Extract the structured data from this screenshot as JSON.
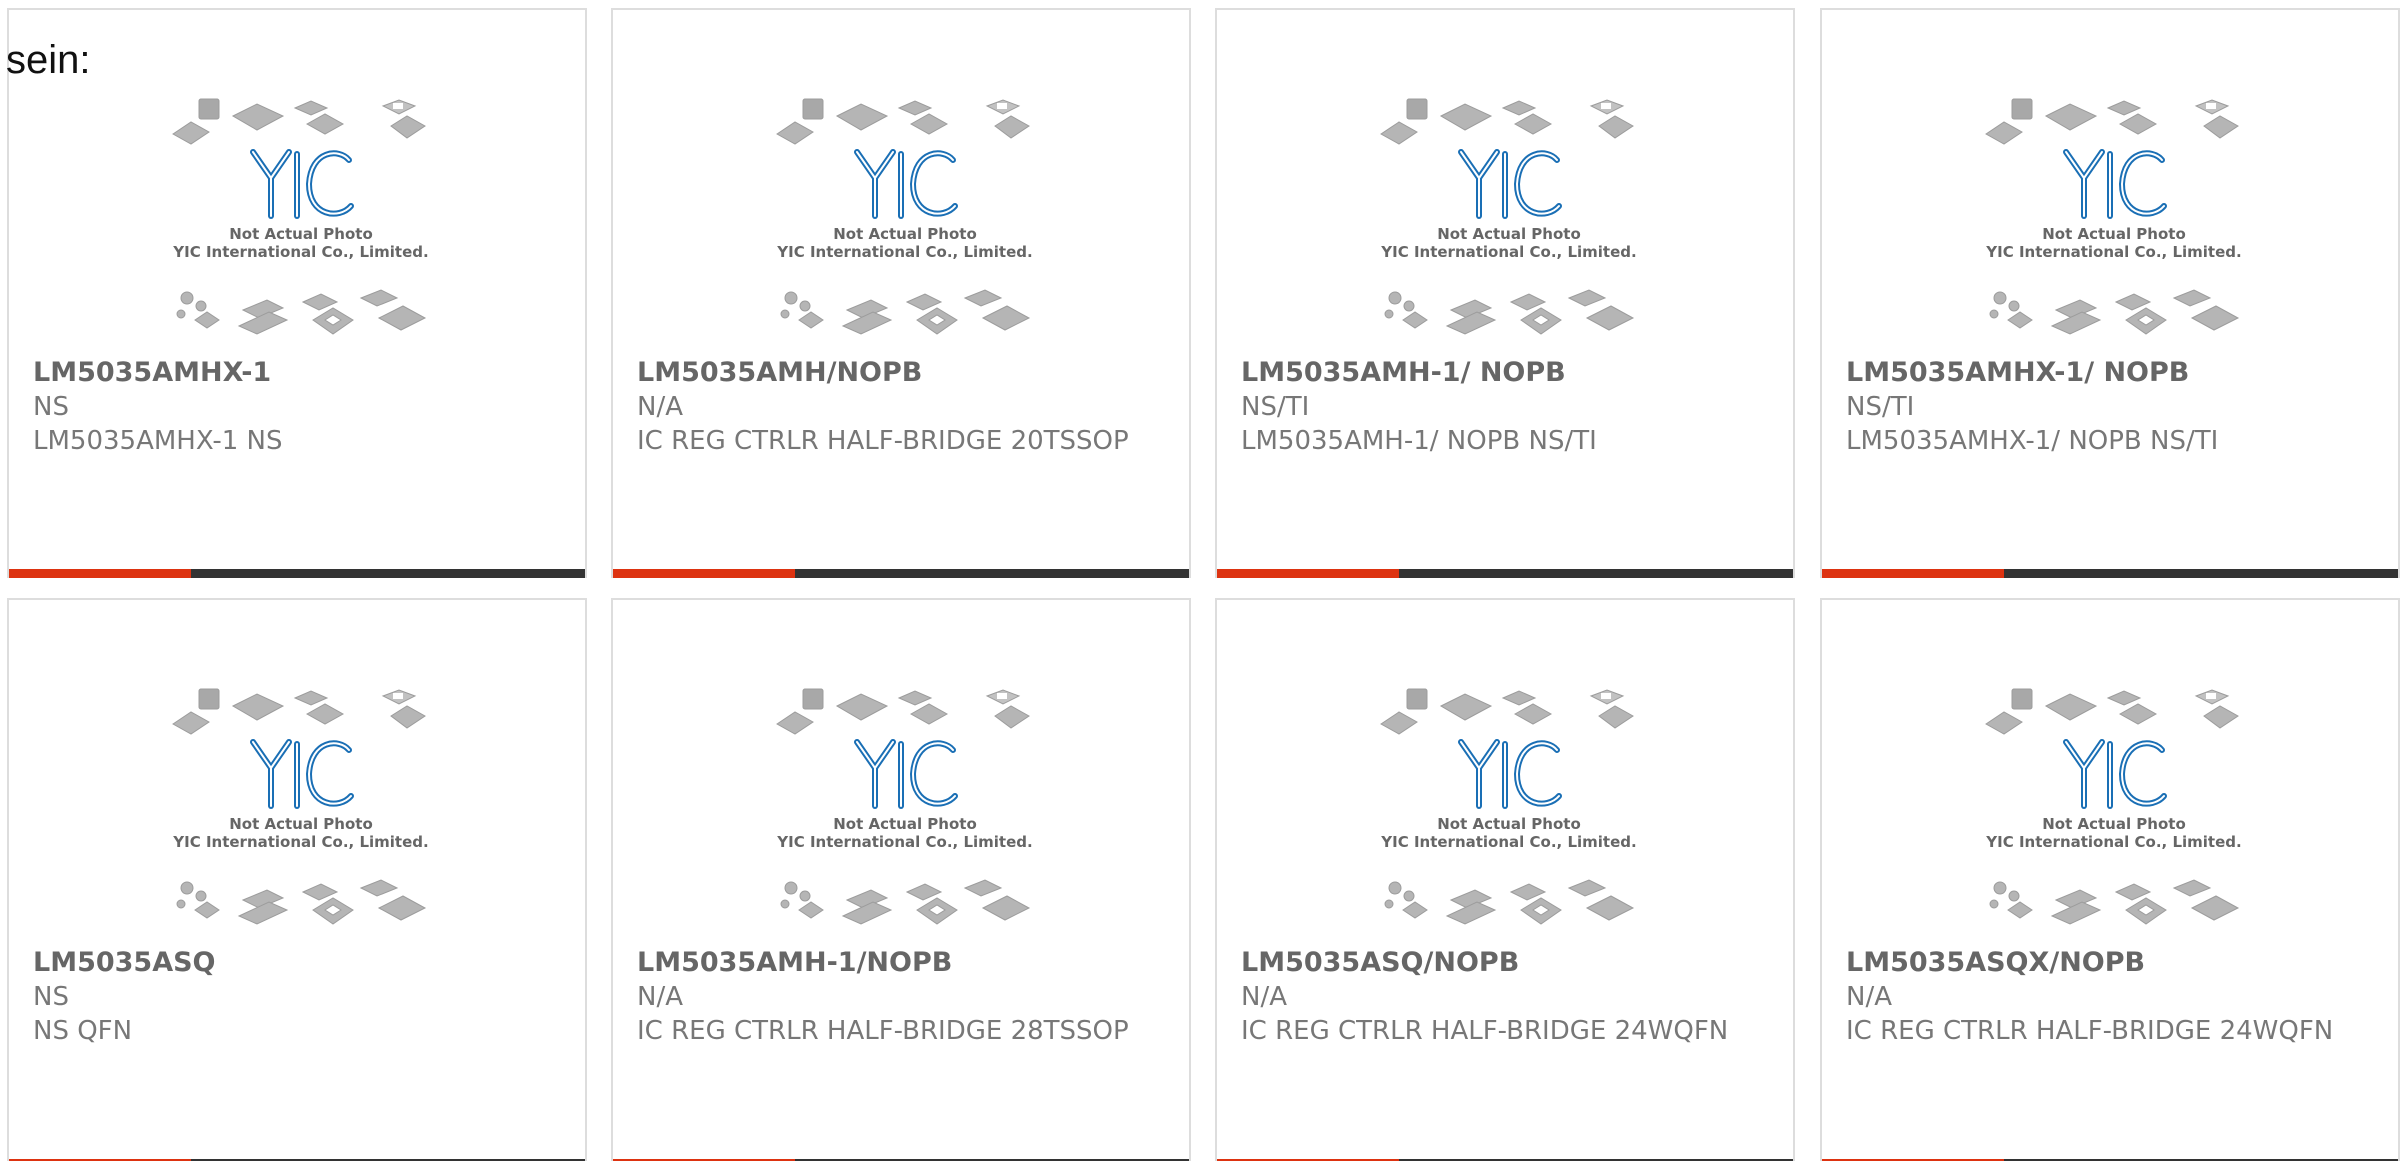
{
  "fragment_text": "sein:",
  "placeholder_photo": {
    "logo_text": "YIC",
    "caption_line1": "Not Actual Photo",
    "caption_line2": "YIC International Co., Limited."
  },
  "colors": {
    "accent": "#dd3311",
    "bar_dark": "#333333",
    "logo_blue": "#1a6fb5",
    "text_gray": "#666666",
    "border": "#dddddd"
  },
  "products": [
    {
      "part_number": "LM5035AMHX-1",
      "manufacturer": "NS",
      "description": "LM5035AMHX-1 NS"
    },
    {
      "part_number": "LM5035AMH/NOPB",
      "manufacturer": "N/A",
      "description": "IC REG CTRLR HALF-BRIDGE 20TSSOP"
    },
    {
      "part_number": "LM5035AMH-1/ NOPB",
      "manufacturer": "NS/TI",
      "description": "LM5035AMH-1/ NOPB NS/TI"
    },
    {
      "part_number": "LM5035AMHX-1/ NOPB",
      "manufacturer": "NS/TI",
      "description": "LM5035AMHX-1/ NOPB NS/TI"
    },
    {
      "part_number": "LM5035ASQ",
      "manufacturer": "NS",
      "description": "NS QFN"
    },
    {
      "part_number": "LM5035AMH-1/NOPB",
      "manufacturer": "N/A",
      "description": "IC REG CTRLR HALF-BRIDGE 28TSSOP"
    },
    {
      "part_number": "LM5035ASQ/NOPB",
      "manufacturer": "N/A",
      "description": "IC REG CTRLR HALF-BRIDGE 24WQFN"
    },
    {
      "part_number": "LM5035ASQX/NOPB",
      "manufacturer": "N/A",
      "description": "IC REG CTRLR HALF-BRIDGE 24WQFN"
    }
  ]
}
